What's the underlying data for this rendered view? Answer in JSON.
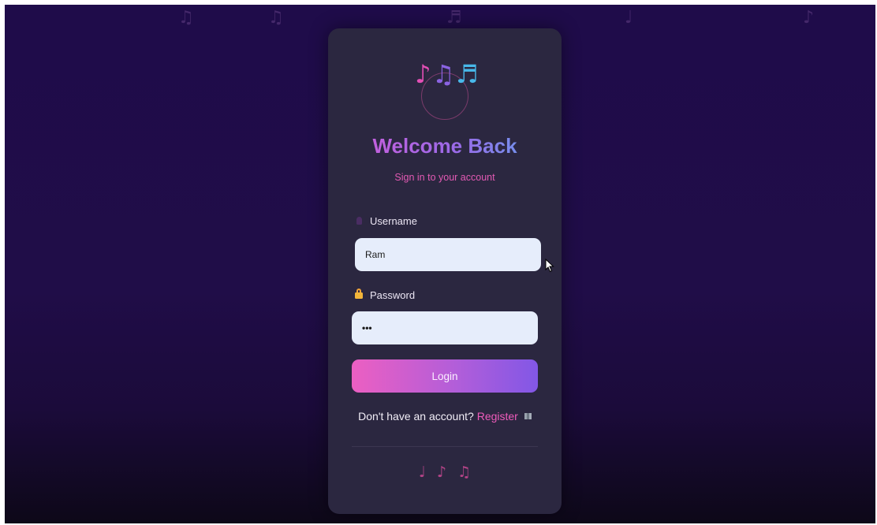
{
  "background_notes": [
    "♫",
    "♫",
    "♬",
    "♩",
    "♪"
  ],
  "logo": {
    "notes": [
      {
        "glyph": "♪",
        "color": "#e24fb5"
      },
      {
        "glyph": "♫",
        "color": "#8b63e3"
      },
      {
        "glyph": "♬",
        "color": "#48b8ea"
      }
    ]
  },
  "header": {
    "title": "Welcome Back",
    "subtitle": "Sign in to your account"
  },
  "form": {
    "username": {
      "label": "Username",
      "value": "Ram",
      "icon": "user-icon"
    },
    "password": {
      "label": "Password",
      "masked_value": "•••",
      "icon": "lock-icon"
    },
    "login_label": "Login"
  },
  "register": {
    "prompt": "Don't have an account?",
    "link": "Register",
    "icon": "map-icon"
  },
  "footer_notes": [
    "♩",
    "♪",
    "♫"
  ],
  "colors": {
    "background": "#1f0c4a",
    "card": "#2b2740",
    "accent_pink": "#ef5bbb",
    "accent_purple": "#8257e6",
    "input_bg": "#e6edfb"
  }
}
